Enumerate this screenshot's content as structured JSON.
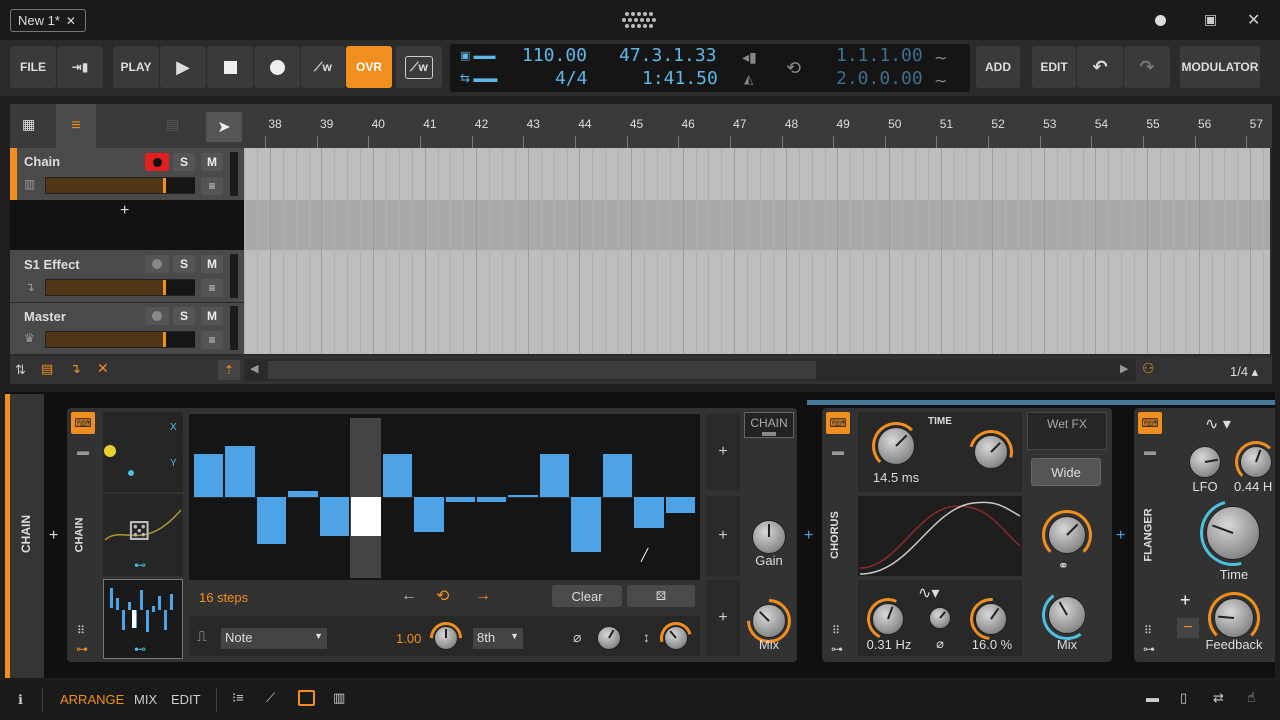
{
  "titlebar": {
    "tab_label": "New 1*",
    "close_glyph": "✕",
    "logo_glyph": "⠿⠿",
    "min_glyph": "●",
    "max_glyph": "▣",
    "close_win_glyph": "✕"
  },
  "toolbar": {
    "file": "FILE",
    "play_label": "PLAY",
    "ovr": "OVR",
    "tempo": "110.00",
    "meter": "4/4",
    "position": "47.3.1.33",
    "time": "1:41.50",
    "loop_start": "1.1.1.00",
    "loop_end": "2.0.0.00",
    "add": "ADD",
    "edit": "EDIT",
    "modulator": "MODULATOR"
  },
  "ruler": {
    "bars": [
      "38",
      "39",
      "40",
      "41",
      "42",
      "43",
      "44",
      "45",
      "46",
      "47",
      "48",
      "49",
      "50",
      "51",
      "52",
      "53",
      "54",
      "55",
      "56",
      "57"
    ]
  },
  "tracks": [
    {
      "name": "Chain",
      "s": "S",
      "m": "M"
    },
    {
      "name": "S1 Effect",
      "s": "S",
      "m": "M"
    },
    {
      "name": "Master",
      "s": "S",
      "m": "M"
    }
  ],
  "arranger_footer": {
    "zoom": "1/4 ▴"
  },
  "device_panel": {
    "side_label": "CHAIN",
    "chain_label": "CHAIN",
    "xy_x": "X",
    "xy_y": "Y",
    "steps_label": "16 steps",
    "clear": "Clear",
    "note_select": "Note",
    "amount": "1.00",
    "rate_select": "8th",
    "chain_box": "CHAIN",
    "gain": "Gain",
    "mix": "Mix",
    "chorus": {
      "title": "CHORUS",
      "time_label": "TIME",
      "time_val": "14.5 ms",
      "rate_val": "0.31 Hz",
      "depth_val": "16.0 %",
      "mix": "Mix",
      "wetfx": "Wet FX",
      "wide": "Wide",
      "phase_glyph": "⌀"
    },
    "flanger": {
      "title": "FLANGER",
      "lfo": "LFO",
      "lfo_val": "0.44 H",
      "time": "Time",
      "feedback": "Feedback"
    }
  },
  "step_values": [
    0.55,
    0.65,
    -0.6,
    0.08,
    -0.5,
    -0.5,
    0.55,
    -0.45,
    -0.06,
    -0.06,
    0.01,
    0.55,
    -0.7,
    0.55,
    -0.4,
    -0.2
  ],
  "bottombar": {
    "arrange": "ARRANGE",
    "mix": "MIX",
    "edit": "EDIT"
  },
  "colors": {
    "accent": "#f08f1f",
    "blue": "#4ea3e6",
    "record": "#e02020"
  }
}
